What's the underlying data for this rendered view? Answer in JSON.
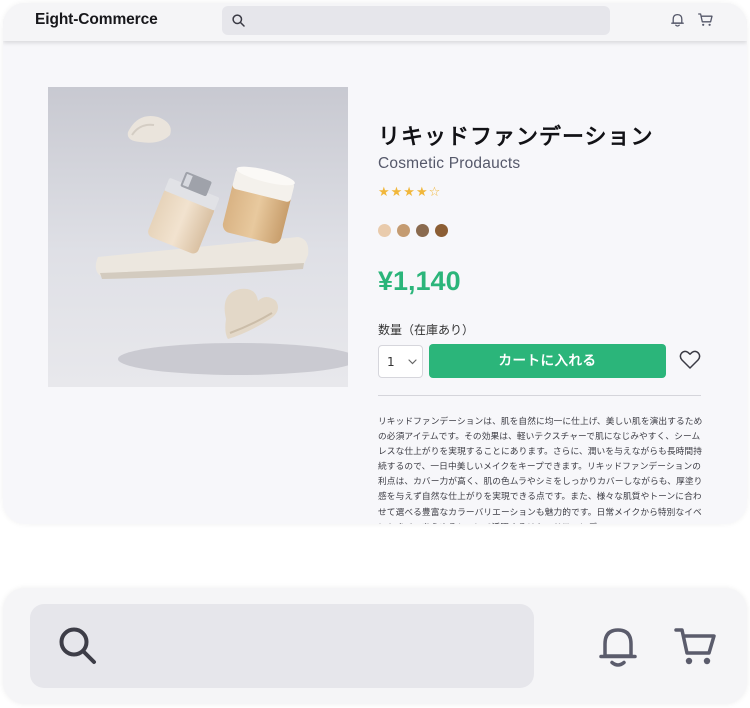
{
  "header": {
    "brand": "Eight-Commerce",
    "search_placeholder": ""
  },
  "product": {
    "title": "リキッドファンデーション",
    "brand_line": "Cosmetic Prodaucts",
    "rating": 4.5,
    "rating_max": 5,
    "stars_display": "★★★★☆",
    "color_swatches": [
      "#e9cbac",
      "#c49b71",
      "#8a6a4e",
      "#8c5e34"
    ],
    "price": "¥1,140",
    "quantity_label": "数量（在庫あり）",
    "quantity_value": "1",
    "add_to_cart_label": "カートに入れる",
    "description": "リキッドファンデーションは、肌を自然に均一に仕上げ、美しい肌を演出するための必須アイテムです。その効果は、軽いテクスチャーで肌になじみやすく、シームレスな仕上がりを実現することにあります。さらに、潤いを与えながらも長時間持続するので、一日中美しいメイクをキープできます。リキッドファンデーションの利点は、カバー力が高く、肌の色ムラやシミをしっかりカバーしながらも、厚塗り感を与えず自然な仕上がりを実現できる点です。また、様々な肌質やトーンに合わせて選べる豊富なカラーバリエーションも魅力的です。日常メイクから特別なイベントまで、あらゆるシーンで活躍するリキッドファンデー"
  },
  "colors": {
    "accent": "#2bb57a",
    "star": "#f1b73b"
  },
  "icons": [
    "search-icon",
    "bell-icon",
    "cart-icon",
    "heart-icon",
    "chevron-down-icon"
  ]
}
